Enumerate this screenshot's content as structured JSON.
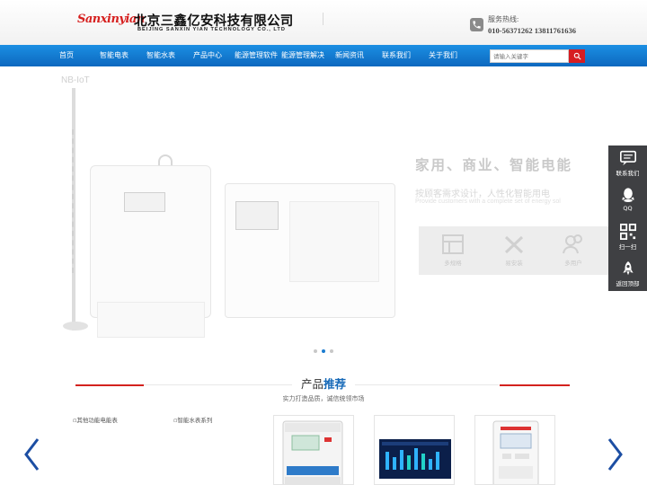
{
  "header": {
    "logo_en": "Sanxinyian",
    "logo_cn": "北京三鑫亿安科技有限公司",
    "logo_sub": "BEIJING SANXIN YIAN TECHNOLOGY CO., LTD",
    "hotline_label": "服务热线:",
    "hotline_numbers": "010-56371262 13811761636"
  },
  "nav": {
    "items": [
      "首页",
      "智能电表",
      "智能水表",
      "产品中心",
      "能源管理软件",
      "能源管理解决方",
      "新闻资讯",
      "联系我们",
      "关于我们"
    ]
  },
  "search": {
    "placeholder": "请输入关键字"
  },
  "banner": {
    "nbiot_label": "NB-IoT",
    "title": "家用、商业、智能电能",
    "subtitle_cn": "按顾客需求设计，人性化智能用电",
    "subtitle_en": "Provide customers with a complete set of energy sol",
    "features": [
      "多规格",
      "易安装",
      "多用户"
    ],
    "slide_count": 3,
    "active_slide": 2
  },
  "sidebar": {
    "items": [
      {
        "label": "联系我们",
        "icon": "chat-icon"
      },
      {
        "label": "QQ",
        "icon": "qq-icon"
      },
      {
        "label": "扫一扫",
        "icon": "qrcode-icon"
      },
      {
        "label": "返回顶部",
        "icon": "rocket-icon"
      }
    ]
  },
  "products_section": {
    "title_prefix": "产品",
    "title_highlight": "推荐",
    "subtitle": "实力打造品质，诚信统领市场",
    "items": [
      {
        "alt": "其他功能电能表"
      },
      {
        "alt": "智能水表系列"
      }
    ]
  },
  "colors": {
    "nav_blue": "#0d68bf",
    "brand_red": "#d61d22",
    "title_blue": "#1669b8",
    "sidebar_dark": "#3f4043"
  }
}
